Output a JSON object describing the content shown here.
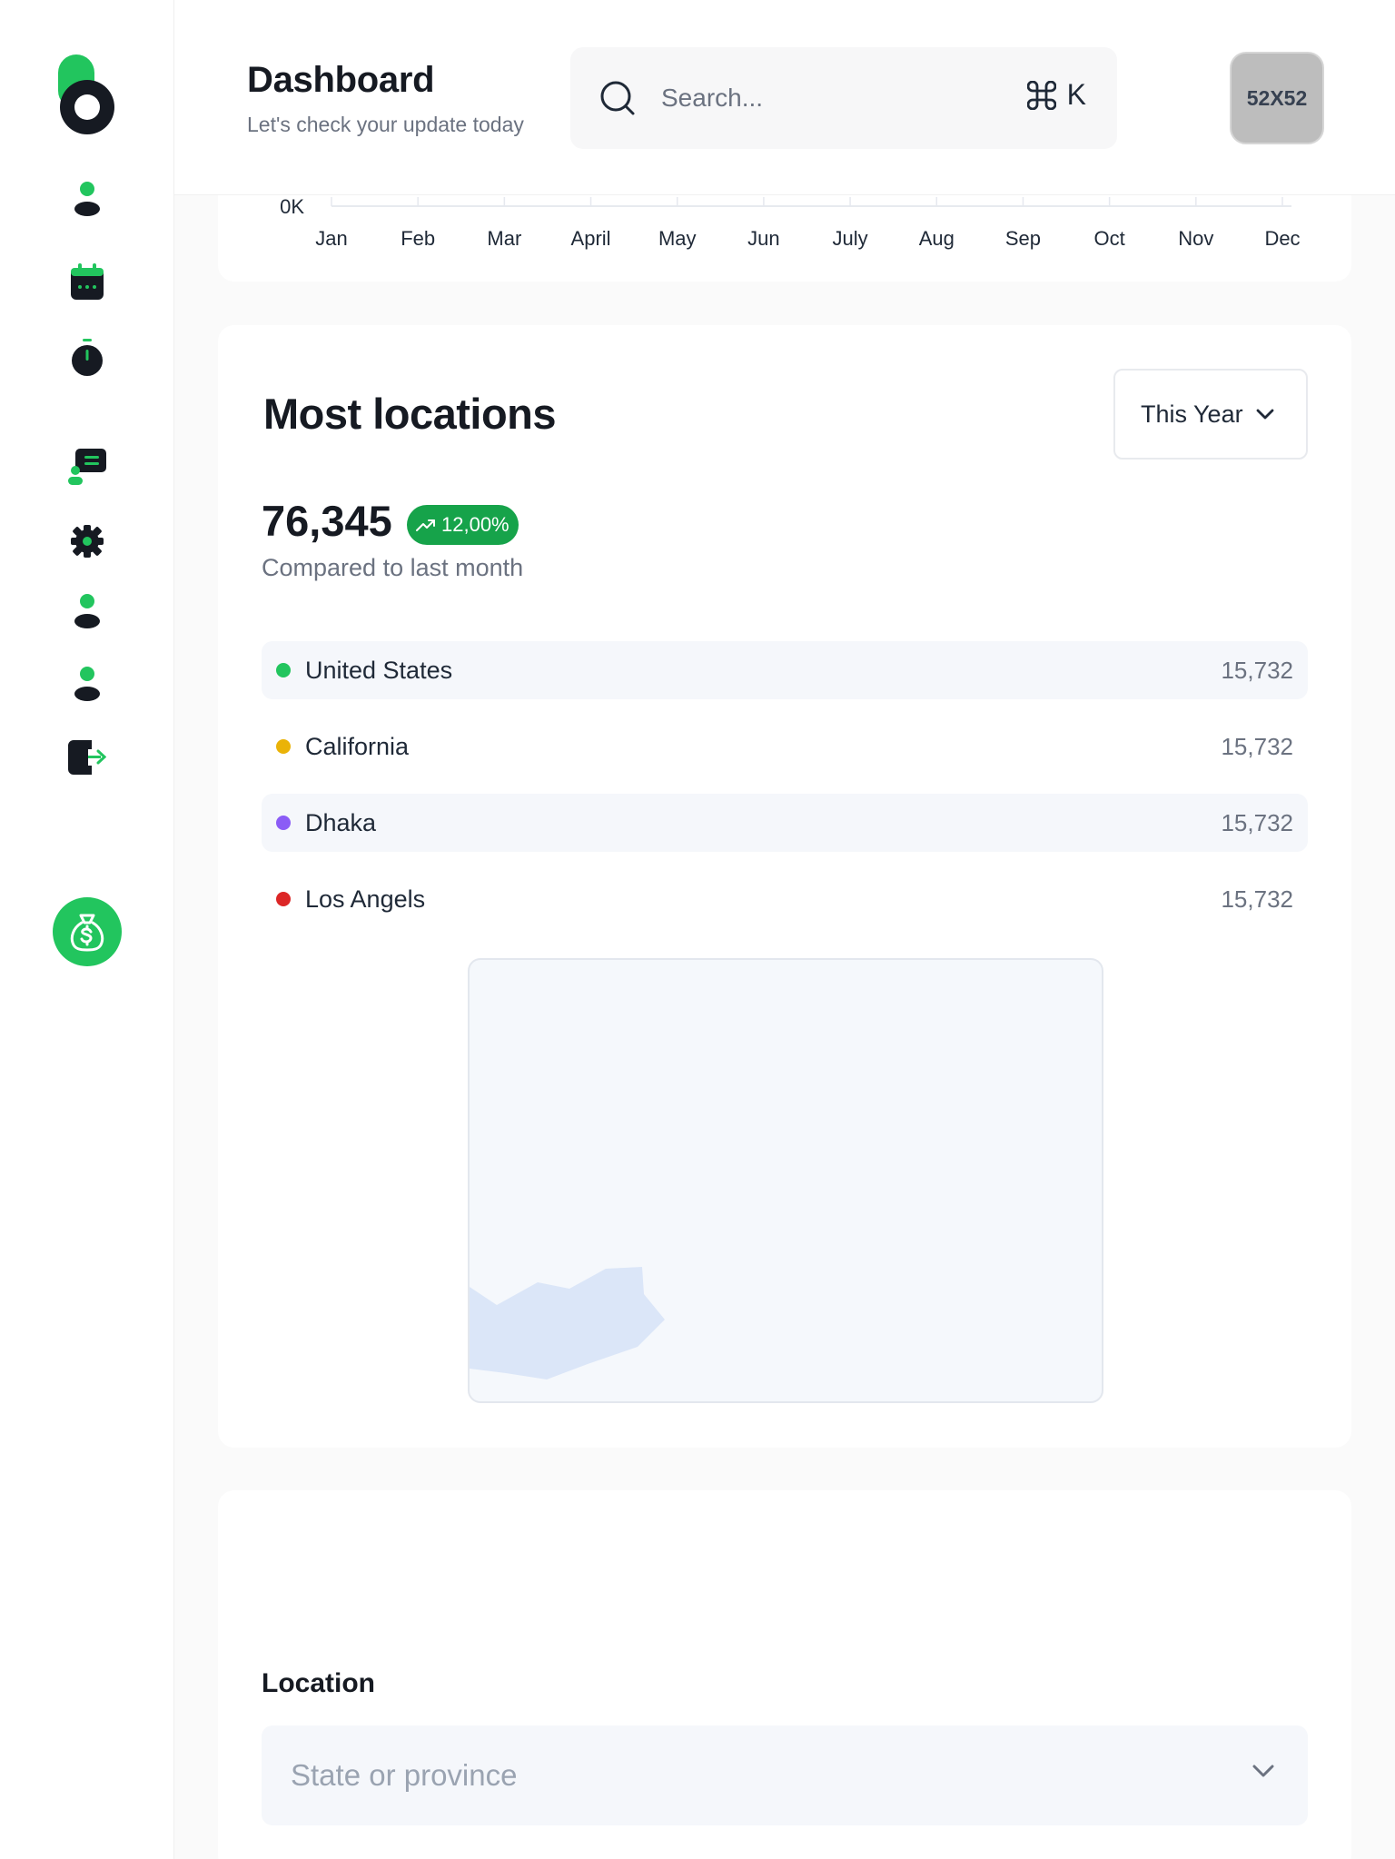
{
  "header": {
    "title": "Dashboard",
    "subtitle": "Let's check your update today",
    "search_placeholder": "Search...",
    "shortcut_key": "K",
    "avatar_label": "52X52"
  },
  "sidebar": {
    "items": [
      {
        "icon": "user-icon"
      },
      {
        "icon": "calendar-icon"
      },
      {
        "icon": "timer-icon"
      },
      {
        "icon": "chat-icon"
      },
      {
        "icon": "gear-icon"
      },
      {
        "icon": "user-icon"
      },
      {
        "icon": "user-icon"
      },
      {
        "icon": "logout-icon"
      },
      {
        "icon": "money-bag-icon"
      }
    ]
  },
  "chart_data": {
    "type": "line",
    "categories": [
      "Jan",
      "Feb",
      "Mar",
      "April",
      "May",
      "Jun",
      "July",
      "Aug",
      "Sep",
      "Oct",
      "Nov",
      "Dec"
    ],
    "y_tick_visible": "0K",
    "partially_visible": true
  },
  "locations_card": {
    "title": "Most locations",
    "period": "This Year",
    "total": "76,345",
    "growth": "12,00%",
    "compare_text": "Compared to last month",
    "rows": [
      {
        "name": "United States",
        "value": "15,732",
        "color": "#22c55e"
      },
      {
        "name": "California",
        "value": "15,732",
        "color": "#eab308"
      },
      {
        "name": "Dhaka",
        "value": "15,732",
        "color": "#8b5cf6"
      },
      {
        "name": "Los Angels",
        "value": "15,732",
        "color": "#dc2626"
      }
    ]
  },
  "form": {
    "location_label": "Location",
    "state_placeholder": "State or province"
  },
  "colors": {
    "accent": "#22c55e",
    "dark": "#161a22"
  }
}
